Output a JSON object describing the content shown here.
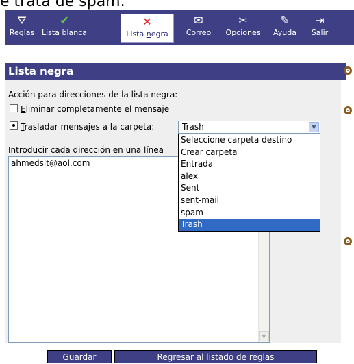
{
  "page_top_text": "e trata de spam.",
  "toolbar": {
    "items": [
      {
        "label_pre": "",
        "label_ul": "R",
        "label_post": "eglas",
        "icon": "filter-funnel-icon",
        "glyph": "⛛",
        "color": "#ffffff"
      },
      {
        "label_pre": "Lista ",
        "label_ul": "b",
        "label_post": "lanca",
        "icon": "checkmark-icon",
        "glyph": "✔",
        "color": "#66cc44"
      },
      {
        "label_pre": "Lista ",
        "label_ul": "n",
        "label_post": "egra",
        "icon": "red-x-icon",
        "glyph": "✕",
        "color": "#e02020"
      },
      {
        "label_pre": "Correo",
        "label_ul": "",
        "label_post": "",
        "icon": "envelope-icon",
        "glyph": "✉",
        "color": "#ffffff"
      },
      {
        "label_pre": "",
        "label_ul": "O",
        "label_post": "pciones",
        "icon": "tools-icon",
        "glyph": "✂",
        "color": "#ffffff"
      },
      {
        "label_pre": "A",
        "label_ul": "y",
        "label_post": "uda",
        "icon": "help-book-icon",
        "glyph": "✎",
        "color": "#ffffff"
      },
      {
        "label_pre": "",
        "label_ul": "S",
        "label_post": "alir",
        "icon": "exit-door-icon",
        "glyph": "⇥",
        "color": "#ffffff"
      }
    ]
  },
  "section_title": "Lista negra",
  "action_label": "Acción para direcciones de la lista negra:",
  "option1": {
    "pre": "",
    "ul": "E",
    "post": "liminar completamente el mensaje"
  },
  "option2": {
    "pre": "",
    "ul": "T",
    "post": "rasladar mensajes a la carpeta:"
  },
  "folder_select": {
    "value": "Trash",
    "options": [
      "Seleccione carpeta destino",
      "Crear carpeta",
      "Entrada",
      "alex",
      "Sent",
      "sent-mail",
      "spam",
      "Trash"
    ],
    "highlighted": "Trash"
  },
  "address_label": {
    "pre": "",
    "ul": "I",
    "post": "ntroducir cada dirección en una línea"
  },
  "address_text": "ahmedslt@aol.com",
  "buttons": {
    "save": "Guardar",
    "back": "Regresar al listado de reglas"
  },
  "colors": {
    "toolbar_bg": "#3f3f86",
    "selection": "#316ac5"
  }
}
